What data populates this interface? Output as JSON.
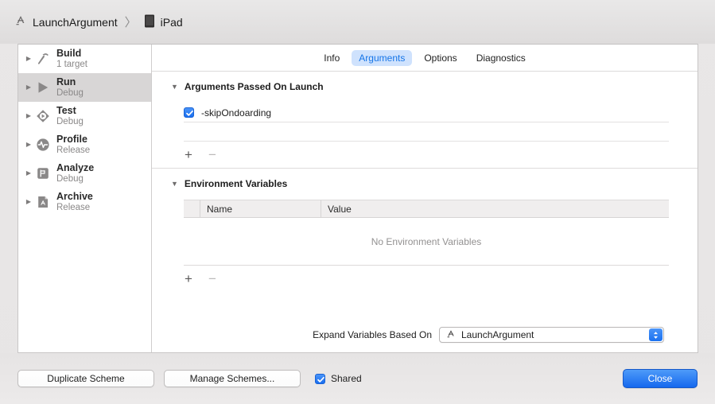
{
  "titlebar": {
    "scheme_name": "LaunchArgument",
    "separator": "〉",
    "destination": "iPad",
    "scheme_icon": "scheme-icon",
    "device_icon": "ipad-icon"
  },
  "sidebar": {
    "items": [
      {
        "title": "Build",
        "subtitle": "1 target",
        "icon": "hammer-icon",
        "selected": false
      },
      {
        "title": "Run",
        "subtitle": "Debug",
        "icon": "play-icon",
        "selected": true
      },
      {
        "title": "Test",
        "subtitle": "Debug",
        "icon": "diamond-play-icon",
        "selected": false
      },
      {
        "title": "Profile",
        "subtitle": "Release",
        "icon": "waveform-icon",
        "selected": false
      },
      {
        "title": "Analyze",
        "subtitle": "Debug",
        "icon": "analyze-icon",
        "selected": false
      },
      {
        "title": "Archive",
        "subtitle": "Release",
        "icon": "archive-icon",
        "selected": false
      }
    ]
  },
  "tabs": [
    {
      "label": "Info",
      "active": false
    },
    {
      "label": "Arguments",
      "active": true
    },
    {
      "label": "Options",
      "active": false
    },
    {
      "label": "Diagnostics",
      "active": false
    }
  ],
  "arguments_section": {
    "title": "Arguments Passed On Launch",
    "expanded": true,
    "items": [
      {
        "checked": true,
        "value": "-skipOndoarding"
      }
    ],
    "add_label": "+",
    "remove_label": "−"
  },
  "environment_section": {
    "title": "Environment Variables",
    "expanded": true,
    "columns": [
      "Name",
      "Value"
    ],
    "rows": [],
    "empty_text": "No Environment Variables",
    "add_label": "+",
    "remove_label": "−"
  },
  "expand_variables": {
    "label": "Expand Variables Based On",
    "selected": "LaunchArgument",
    "icon": "scheme-icon"
  },
  "bottom_bar": {
    "duplicate_label": "Duplicate Scheme",
    "manage_label": "Manage Schemes...",
    "shared_label": "Shared",
    "shared_checked": true,
    "close_label": "Close"
  },
  "colors": {
    "accent_blue": "#1568ee",
    "tab_active_bg": "#cfe2fd",
    "tab_active_text": "#1575e8",
    "selected_row_bg": "#d8d6d6",
    "muted_text": "#8a8888"
  }
}
